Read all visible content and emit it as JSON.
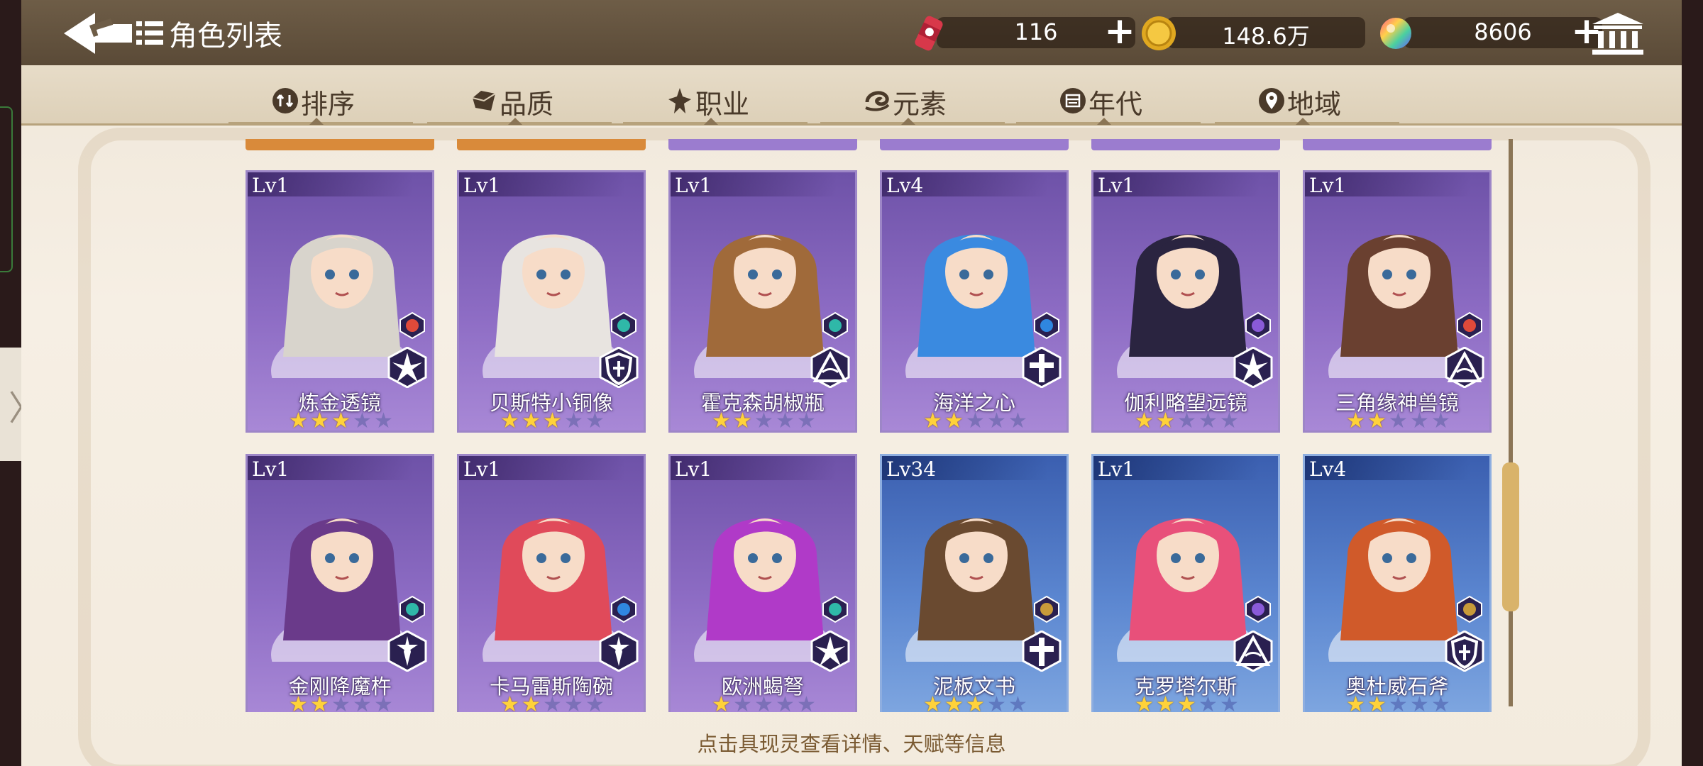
{
  "header": {
    "title": "角色列表",
    "resources": [
      {
        "name": "stamina",
        "icon": "soda-can-icon",
        "value": "116"
      },
      {
        "name": "gold",
        "icon": "gold-coin-icon",
        "value": "148.6万"
      },
      {
        "name": "gems",
        "icon": "rainbow-gem-icon",
        "value": "8606"
      }
    ]
  },
  "filters": [
    {
      "label": "排序",
      "icon": "sort-icon"
    },
    {
      "label": "品质",
      "icon": "quality-gem-icon"
    },
    {
      "label": "职业",
      "icon": "class-emblem-icon"
    },
    {
      "label": "元素",
      "icon": "element-swirl-icon"
    },
    {
      "label": "年代",
      "icon": "calendar-icon"
    },
    {
      "label": "地域",
      "icon": "location-pin-icon"
    }
  ],
  "cards": [
    {
      "level": "Lv1",
      "name": "炼金透镜",
      "stars": 3,
      "theme": "purple",
      "element": "fire",
      "role": "assassin",
      "elementColor": "#e04a3a"
    },
    {
      "level": "Lv1",
      "name": "贝斯特小铜像",
      "stars": 3,
      "theme": "purple",
      "element": "wind",
      "role": "guardian",
      "elementColor": "#2fb8a8"
    },
    {
      "level": "Lv1",
      "name": "霍克森胡椒瓶",
      "stars": 2,
      "theme": "purple",
      "element": "wind",
      "role": "mage",
      "elementColor": "#2fb8a8"
    },
    {
      "level": "Lv4",
      "name": "海洋之心",
      "stars": 2,
      "theme": "purple",
      "element": "water",
      "role": "healer",
      "elementColor": "#2f86e0"
    },
    {
      "level": "Lv1",
      "name": "伽利略望远镜",
      "stars": 2,
      "theme": "purple",
      "element": "lightning",
      "role": "assassin",
      "elementColor": "#8a5ad8"
    },
    {
      "level": "Lv1",
      "name": "三角缘神兽镜",
      "stars": 2,
      "theme": "purple",
      "element": "fire",
      "role": "mage",
      "elementColor": "#e04a3a"
    },
    {
      "level": "Lv1",
      "name": "金刚降魔杵",
      "stars": 2,
      "theme": "purple",
      "element": "wind",
      "role": "warrior",
      "elementColor": "#2fb8a8"
    },
    {
      "level": "Lv1",
      "name": "卡马雷斯陶碗",
      "stars": 2,
      "theme": "purple",
      "element": "water",
      "role": "warrior",
      "elementColor": "#2f86e0"
    },
    {
      "level": "Lv1",
      "name": "欧洲蝎弩",
      "stars": 1,
      "theme": "purple",
      "element": "wind",
      "role": "assassin",
      "elementColor": "#2fb8a8"
    },
    {
      "level": "Lv34",
      "name": "泥板文书",
      "stars": 3,
      "theme": "blue",
      "element": "earth",
      "role": "healer",
      "elementColor": "#c89a3a"
    },
    {
      "level": "Lv1",
      "name": "克罗塔尔斯",
      "stars": 3,
      "theme": "blue",
      "element": "lightning",
      "role": "mage",
      "elementColor": "#8a5ad8"
    },
    {
      "level": "Lv4",
      "name": "奥杜威石斧",
      "stars": 2,
      "theme": "blue",
      "element": "earth",
      "role": "guardian",
      "elementColor": "#c89a3a"
    }
  ],
  "maxStars": 5,
  "hint": "点击具现灵查看详情、天赋等信息"
}
